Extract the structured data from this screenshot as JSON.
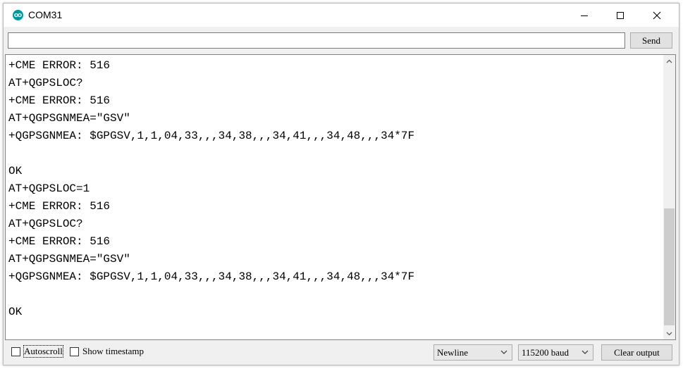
{
  "window": {
    "title": "COM31",
    "app_icon": "arduino-infinity-icon",
    "controls": [
      "minimize-icon",
      "maximize-icon",
      "close-icon"
    ]
  },
  "input": {
    "value": "",
    "send_label": "Send"
  },
  "output": {
    "lines": [
      "+CME ERROR: 516",
      "AT+QGPSLOC?",
      "+CME ERROR: 516",
      "AT+QGPSGNMEA=\"GSV\"",
      "+QGPSGNMEA: $GPGSV,1,1,04,33,,,34,38,,,34,41,,,34,48,,,34*7F",
      "",
      "OK",
      "AT+QGPSLOC=1",
      "+CME ERROR: 516",
      "AT+QGPSLOC?",
      "+CME ERROR: 516",
      "AT+QGPSGNMEA=\"GSV\"",
      "+QGPSGNMEA: $GPGSV,1,1,04,33,,,34,38,,,34,41,,,34,48,,,34*7F",
      "",
      "OK"
    ]
  },
  "footer": {
    "autoscroll_label": "Autoscroll",
    "autoscroll_checked": false,
    "timestamp_label": "Show timestamp",
    "timestamp_checked": false,
    "line_ending": "Newline",
    "baud_rate": "115200 baud",
    "clear_label": "Clear output"
  },
  "colors": {
    "accent": "#00979c",
    "window_bg": "#f0f0f0",
    "scroll_thumb": "#cdcdcd"
  }
}
